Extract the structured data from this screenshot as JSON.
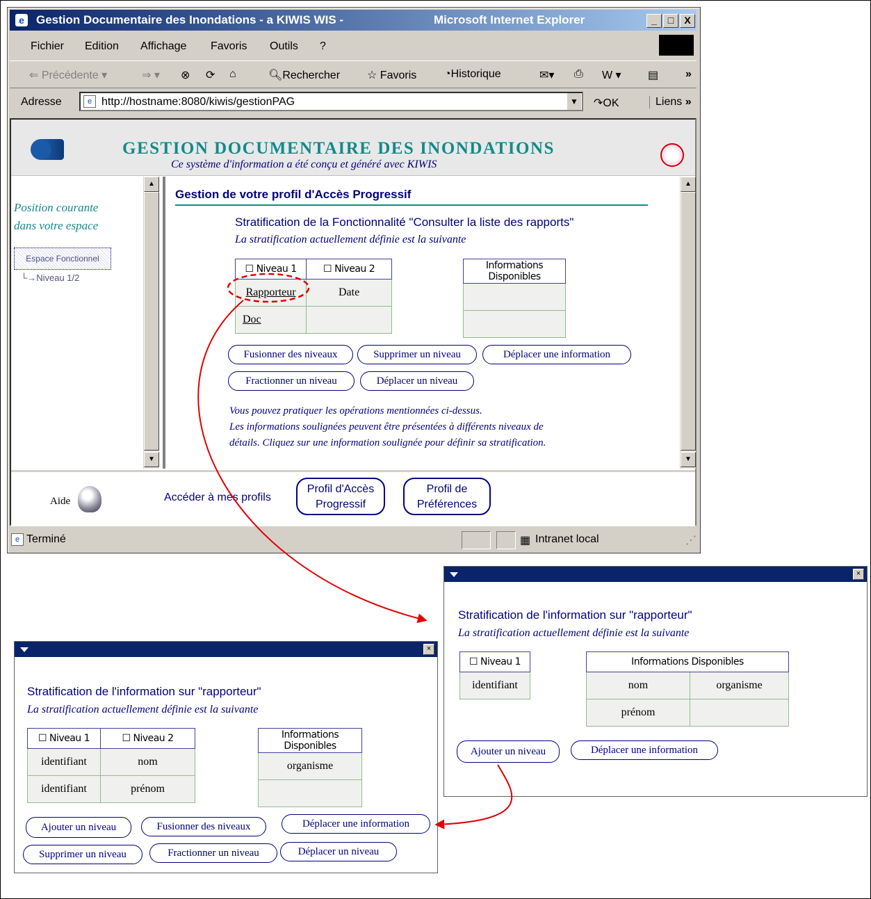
{
  "window": {
    "title_left": "Gestion Documentaire des Inondations - a KIWIS WIS -",
    "title_right": "Microsoft Internet Explorer",
    "controls": [
      "_",
      "□",
      "X"
    ]
  },
  "menu": [
    "Fichier",
    "Edition",
    "Affichage",
    "Favoris",
    "Outils",
    "?"
  ],
  "toolbar": {
    "back": "Précédente",
    "search": "Rechercher",
    "favorites": "Favoris",
    "history": "Historique"
  },
  "address": {
    "label": "Adresse",
    "url": "http://hostname:8080/kiwis/gestionPAG",
    "go": "OK",
    "links": "Liens"
  },
  "banner": {
    "title": "GESTION DOCUMENTAIRE DES INONDATIONS",
    "subtitle": "Ce système d'information a été conçu et généré avec KIWIS"
  },
  "sidebar": {
    "position": "Position courante dans votre espace",
    "position_line1": "Position courante",
    "position_line2": "dans votre espace",
    "item1": "Espace Fonctionnel",
    "item2": "Niveau 1/2"
  },
  "main": {
    "heading": "Gestion de votre profil d'Accès Progressif",
    "strat_title": "Stratification de la Fonctionnalité \"Consulter la liste des rapports\"",
    "strat_sub": "La stratification actuellement définie est la suivante",
    "col1": "Niveau 1",
    "col2": "Niveau 2",
    "rows": [
      [
        "Rapporteur",
        "Date"
      ],
      [
        "Doc",
        ""
      ]
    ],
    "info_header": "Informations Disponibles",
    "buttons": [
      "Fusionner des niveaux",
      "Supprimer un niveau",
      "Déplacer une information",
      "Fractionner un niveau",
      "Déplacer un niveau"
    ],
    "note_l1": "Vous pouvez pratiquer les opérations mentionnées ci-dessus.",
    "note_l2": "Les informations soulignées peuvent être présentées à différents niveaux de",
    "note_l3": "détails. Cliquez sur une information soulignée pour définir sa stratification."
  },
  "footer": {
    "help": "Aide",
    "access": "Accéder à mes profils",
    "btn1_l1": "Profil d'Accès",
    "btn1_l2": "Progressif",
    "btn2_l1": "Profil de",
    "btn2_l2": "Préférences"
  },
  "status": {
    "left": "Terminé",
    "zone": "Intranet local"
  },
  "popup_right": {
    "title": "Stratification de l'information sur \"rapporteur\"",
    "sub": "La stratification actuellement définie est la suivante",
    "col1": "Niveau 1",
    "row1": "identifiant",
    "info_header": "Informations Disponibles",
    "info_cells": [
      [
        "nom",
        "organisme"
      ],
      [
        "prénom",
        ""
      ]
    ],
    "buttons": [
      "Ajouter un niveau",
      "Déplacer une information"
    ]
  },
  "popup_left": {
    "title": "Stratification de l'information sur \"rapporteur\"",
    "sub": "La stratification actuellement définie est la suivante",
    "col1": "Niveau 1",
    "col2": "Niveau 2",
    "rows": [
      [
        "identifiant",
        "nom"
      ],
      [
        "identifiant",
        "prénom"
      ]
    ],
    "info_header": "Informations Disponibles",
    "info_cells": [
      "organisme",
      ""
    ],
    "buttons": [
      "Ajouter un niveau",
      "Fusionner des niveaux",
      "Déplacer une information",
      "Supprimer un niveau",
      "Fractionner un niveau",
      "Déplacer un niveau"
    ]
  },
  "colors": {
    "title_bar": "#0a246a",
    "link_navy": "#000080",
    "teal": "#138a8a",
    "arrow": "#e00000"
  }
}
